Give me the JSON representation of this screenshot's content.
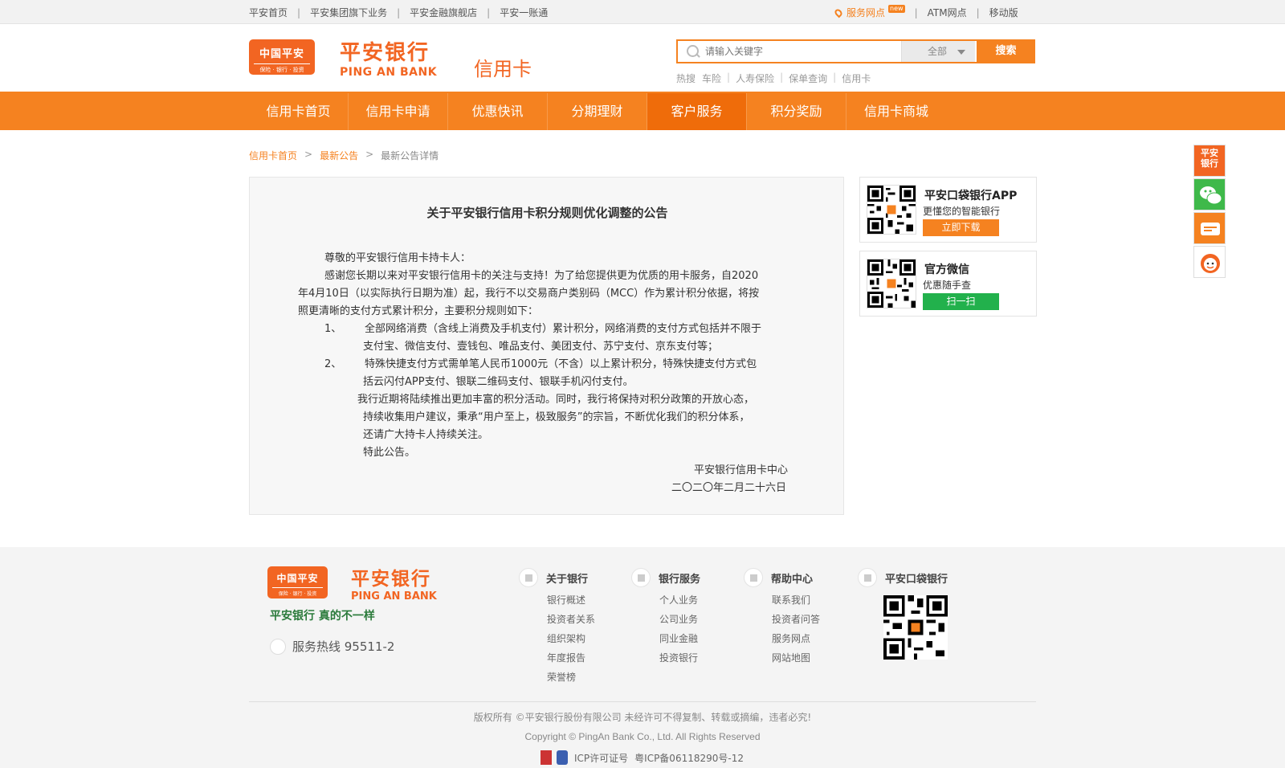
{
  "topbar": {
    "links": [
      "平安首页",
      "平安集团旗下业务",
      "平安金融旗舰店",
      "平安一账通"
    ],
    "service_points": "服务网点",
    "service_badge": "new",
    "atm": "ATM网点",
    "mobile": "移动版"
  },
  "header": {
    "logo_badge_cn": "中国平安",
    "logo_badge_sub": "保险 · 银行 · 投资",
    "bank_cn": "平安银行",
    "bank_en": "PING AN BANK",
    "section": "信用卡",
    "search_placeholder": "请输入关键字",
    "search_scope": "全部",
    "search_button": "搜索",
    "hot_label": "热搜",
    "hot_terms": [
      "车险",
      "人寿保险",
      "保单查询",
      "信用卡"
    ]
  },
  "nav": {
    "items": [
      "信用卡首页",
      "信用卡申请",
      "优惠快讯",
      "分期理财",
      "客户服务",
      "积分奖励",
      "信用卡商城"
    ],
    "active_index": 4
  },
  "breadcrumb": {
    "home": "信用卡首页",
    "list": "最新公告",
    "current": "最新公告详情",
    "separator": ">"
  },
  "article": {
    "title": "关于平安银行信用卡积分规则优化调整的公告",
    "greeting": "尊敬的平安银行信用卡持卡人：",
    "p1_l1": "感谢您长期以来对平安银行信用卡的关注与支持！为了给您提供更为优质的用卡服务，自2020",
    "p1_l2": "年4月10日（以实际执行日期为准）起，我行不以交易商户类别码（MCC）作为累计积分依据，将按",
    "p1_l3": "照更清晰的支付方式累计积分，主要积分规则如下：",
    "item1_num": "1、",
    "item1_l1": "全部网络消费（含线上消费及手机支付）累计积分，网络消费的支付方式包括并不限于",
    "item1_l2": "支付宝、微信支付、壹钱包、唯品支付、美团支付、苏宁支付、京东支付等；",
    "item2_num": "2、",
    "item2_l1": "特殊快捷支付方式需单笔人民币1000元（不含）以上累计积分，特殊快捷支付方式包",
    "item2_l2": "括云闪付APP支付、银联二维码支付、银联手机闪付支付。",
    "p2_l1": "我行近期将陆续推出更加丰富的积分活动。同时，我行将保持对积分政策的开放心态，",
    "p2_l2": "持续收集用户建议，秉承“用户至上，极致服务”的宗旨，不断优化我们的积分体系，",
    "p2_l3": "还请广大持卡人持续关注。",
    "closing": "特此公告。",
    "signature": "平安银行信用卡中心",
    "date": "二〇二〇年二月二十六日"
  },
  "sidebar": {
    "app_title": "平安口袋银行APP",
    "app_subtitle": "更懂您的智能银行",
    "app_button": "立即下载",
    "wechat_title": "官方微信",
    "wechat_subtitle": "优惠随手查",
    "wechat_button": "扫一扫"
  },
  "float": {
    "bank_text": "平安银行"
  },
  "footer": {
    "logo_badge_cn": "中国平安",
    "logo_badge_sub": "保险 · 银行 · 投资",
    "bank_cn": "平安银行",
    "bank_en": "PING AN BANK",
    "slogan": "平安银行  真的不一样",
    "hotline": "服务热线  95511-2",
    "col1": {
      "title": "关于银行",
      "items": [
        "银行概述",
        "投资者关系",
        "组织架构",
        "年度报告",
        "荣誉榜"
      ]
    },
    "col2": {
      "title": "银行服务",
      "items": [
        "个人业务",
        "公司业务",
        "同业金融",
        "投资银行"
      ]
    },
    "col3": {
      "title": "帮助中心",
      "items": [
        "联系我们",
        "投资者问答",
        "服务网点",
        "网站地图"
      ]
    },
    "col4": {
      "title": "平安口袋银行"
    },
    "copyright_cn": "版权所有 ©平安银行股份有限公司 未经许可不得复制、转载或摘编，违者必究!",
    "copyright_en": "Copyright © PingAn Bank Co., Ltd. All Rights Reserved",
    "icp_label": "ICP许可证号",
    "icp_number": "粤ICP备06118290号-12"
  },
  "colors": {
    "brand_orange": "#f58220",
    "logo_orange": "#f26522",
    "green": "#22b14c"
  }
}
